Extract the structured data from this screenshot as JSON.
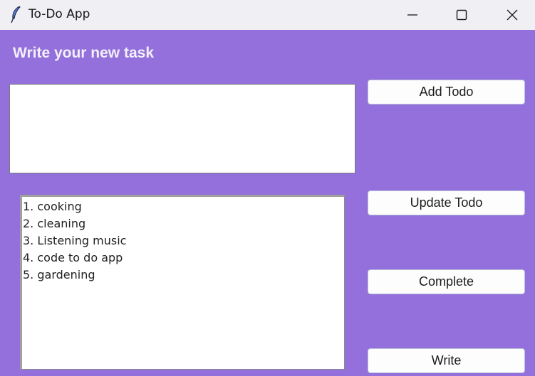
{
  "window": {
    "title": "To-Do App",
    "icons": {
      "app": "feather-icon",
      "minimize": "minimize-icon",
      "maximize": "maximize-icon",
      "close": "close-icon"
    },
    "background_color": "#9370DB"
  },
  "main": {
    "heading": "Write your new task",
    "task_input": {
      "value": "",
      "placeholder": ""
    },
    "buttons": {
      "add": "Add Todo",
      "update": "Update Todo",
      "complete": "Complete",
      "write": "Write"
    },
    "todos": [
      "1. cooking",
      "2. cleaning",
      "3. Listening music",
      "4. code to do app",
      "5. gardening"
    ]
  }
}
